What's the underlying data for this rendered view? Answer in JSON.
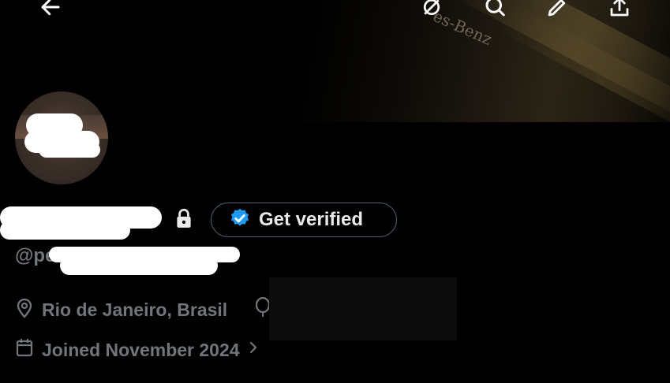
{
  "banner": {
    "brand_text": "es-Benz"
  },
  "topbar": {
    "icons": [
      "back-arrow-icon",
      "grok-icon",
      "search-icon",
      "edit-icon",
      "share-icon"
    ]
  },
  "profile": {
    "handle_prefix": "@pe",
    "verify_button_label": "Get verified",
    "location": "Rio de Janeiro, Brasil",
    "joined": "Joined November 2024"
  },
  "colors": {
    "background": "#000000",
    "primary_text": "#e7e9ea",
    "secondary_text": "#71767b",
    "border": "#536471",
    "verified_blue": "#1d9bf0"
  }
}
